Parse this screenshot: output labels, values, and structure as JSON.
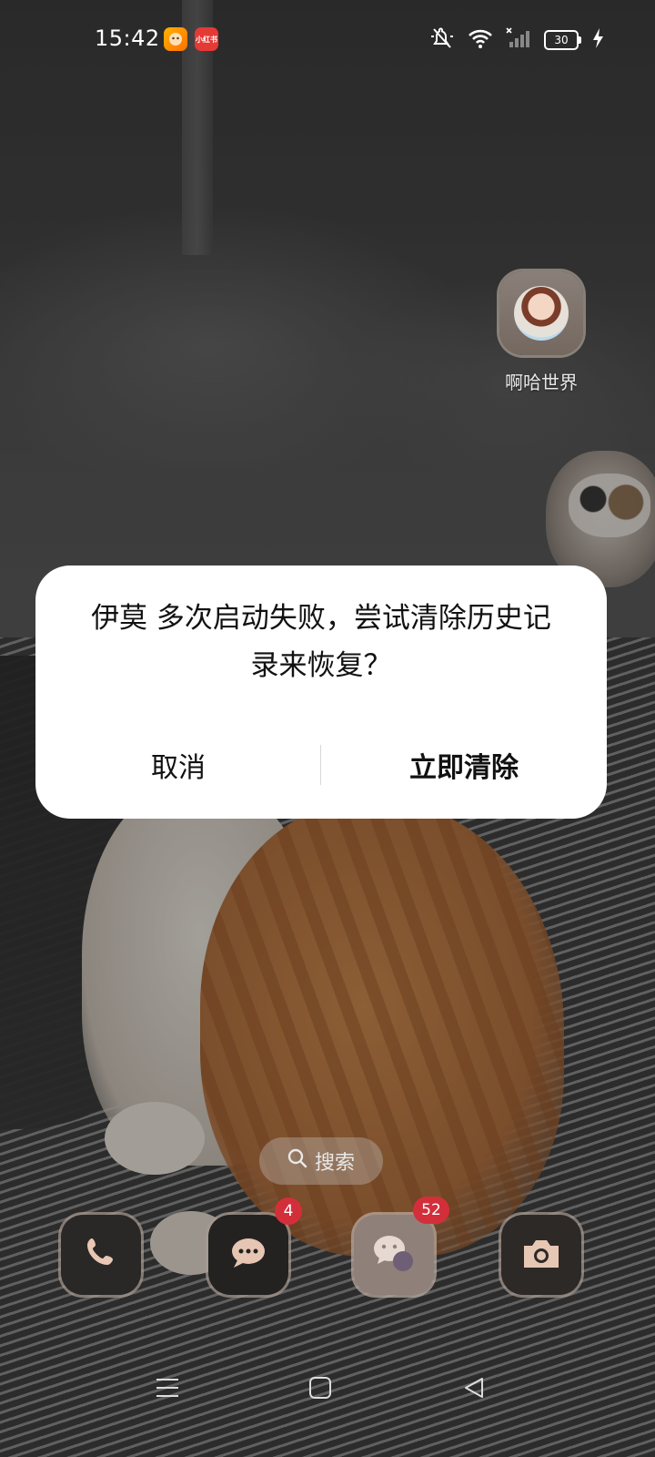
{
  "status_bar": {
    "time": "15:42",
    "notification_icons": [
      "app-notification-icon",
      "xiaohongshu-notification-icon"
    ],
    "notification_2_text": "小红书",
    "battery_level": "30",
    "icons": [
      "mute-icon",
      "wifi-icon",
      "signal-icon",
      "battery-icon",
      "charging-icon"
    ]
  },
  "home_apps": {
    "top_right_app": {
      "label": "啊哈世界",
      "icon": "aha-world-app-icon"
    }
  },
  "dialog": {
    "message": "伊莫 多次启动失败，尝试清除历史记录来恢复？",
    "cancel_label": "取消",
    "confirm_label": "立即清除"
  },
  "search": {
    "label": "搜索",
    "icon": "search-icon"
  },
  "dock": {
    "apps": [
      {
        "name": "phone",
        "icon": "phone-icon",
        "badge": ""
      },
      {
        "name": "messages",
        "icon": "chat-bubble-icon",
        "badge": "4"
      },
      {
        "name": "wechat",
        "icon": "wechat-icon",
        "badge": "52"
      },
      {
        "name": "camera",
        "icon": "camera-icon",
        "badge": ""
      }
    ]
  },
  "nav_bar": {
    "icons": [
      "menu-icon",
      "home-icon",
      "back-icon"
    ]
  },
  "colors": {
    "dialog_bg": "#ffffff",
    "badge": "#d32f3b",
    "text_dark": "#111111"
  }
}
